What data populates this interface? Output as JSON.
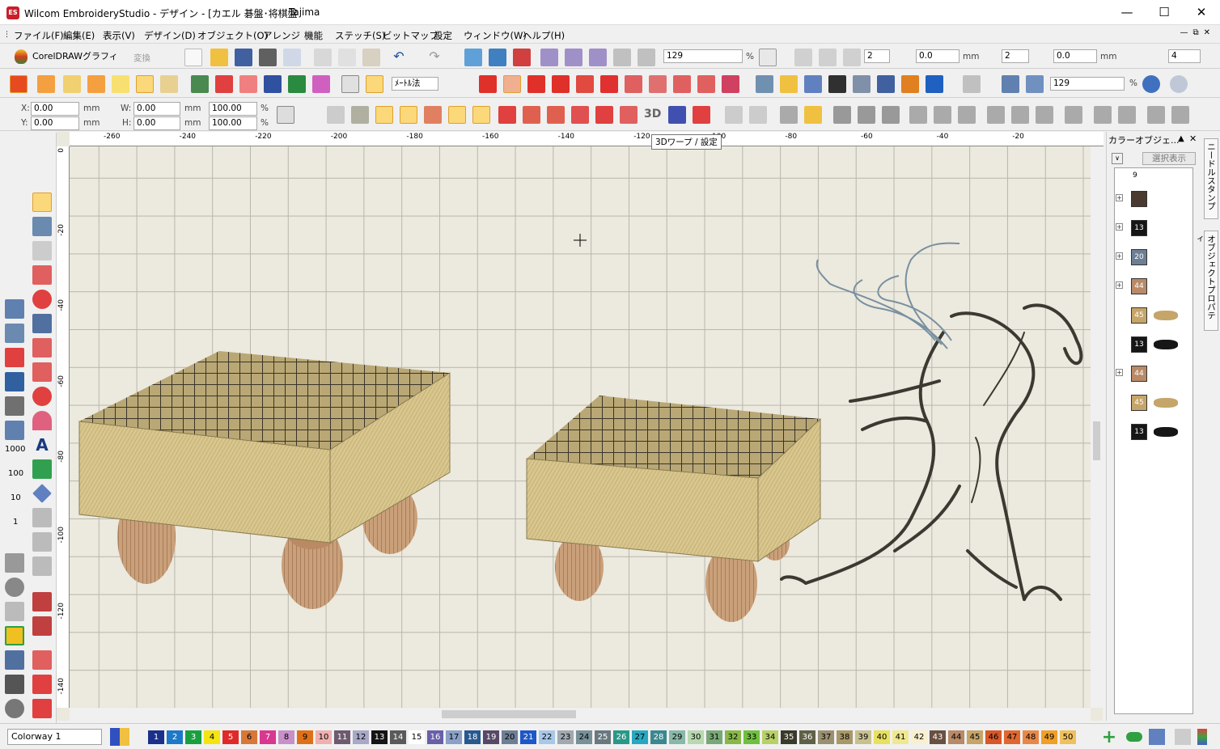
{
  "window": {
    "title": "Wilcom EmbroideryStudio - デザイン - [カエル 碁盤･将棋盤",
    "machine": "Tajima",
    "app_icon": "ES"
  },
  "menu": [
    "ファイル(F)",
    "編集(E)",
    "表示(V)",
    "デザイン(D)",
    "オブジェクト(O)",
    "アレンジ",
    "機能",
    "ステッチ(S)",
    "ビットマップ",
    "設定",
    "ウィンドウ(W)",
    "ヘルプ(H)"
  ],
  "toolbar": {
    "corel_label": "CorelDRAWグラフィック",
    "convert_label": "変換",
    "zoom1": "129",
    "zoom_unit": "%",
    "spin_a": "2",
    "spin_b": "0.0",
    "spin_c": "2",
    "spin_d": "0.0",
    "spin_e": "4",
    "unit_mm": "mm",
    "units_select": "ﾒｰﾄﾙ法",
    "zoom2": "129",
    "zoom2_unit": "%",
    "icon_3d": "3D"
  },
  "coords": {
    "x_label": "X:",
    "x": "0.00",
    "y_label": "Y:",
    "y": "0.00",
    "w_label": "W:",
    "w": "0.00",
    "h_label": "H:",
    "h": "0.00",
    "sx": "100.00",
    "sy": "100.00",
    "mm": "mm",
    "pct": "%"
  },
  "tooltip": "3Dワープ / 設定",
  "ruler": {
    "top": [
      "-260",
      "-240",
      "-220",
      "-200",
      "-180",
      "-160",
      "-140",
      "-120",
      "-100",
      "-80",
      "-60",
      "-40",
      "-20"
    ],
    "left": [
      "0",
      "-20",
      "-40",
      "-60",
      "-80",
      "-100",
      "-120",
      "-140"
    ],
    "vertical_tool_labels": [
      "1000",
      "100",
      "10",
      "1"
    ]
  },
  "color_object_panel": {
    "title": "カラーオブジェ...",
    "button": "選択表示",
    "count": "9",
    "rows": [
      {
        "code": "",
        "color": "#4a3a30",
        "expand": "+"
      },
      {
        "code": "13",
        "color": "#161616",
        "expand": "+"
      },
      {
        "code": "20",
        "color": "#6e7f95",
        "expand": "+"
      },
      {
        "code": "44",
        "color": "#b88a68",
        "expand": "+"
      },
      {
        "code": "45",
        "color": "#c6a56a",
        "expand": ""
      },
      {
        "code": "13",
        "color": "#161616",
        "expand": ""
      },
      {
        "code": "44",
        "color": "#b88a68",
        "expand": "+"
      },
      {
        "code": "45",
        "color": "#c6a56a",
        "expand": ""
      },
      {
        "code": "13",
        "color": "#161616",
        "expand": ""
      }
    ]
  },
  "side_tabs": [
    "ニードルスタンプ",
    "オブジェクトプロパティ"
  ],
  "status": {
    "colorway": "Colorway 1"
  },
  "palette": [
    {
      "n": "1",
      "c": "#1b2f8c"
    },
    {
      "n": "2",
      "c": "#1e78c8"
    },
    {
      "n": "3",
      "c": "#18a040"
    },
    {
      "n": "4",
      "c": "#f4e414"
    },
    {
      "n": "5",
      "c": "#e02a2a"
    },
    {
      "n": "6",
      "c": "#d87838"
    },
    {
      "n": "7",
      "c": "#d83890"
    },
    {
      "n": "8",
      "c": "#c890c8"
    },
    {
      "n": "9",
      "c": "#e07018"
    },
    {
      "n": "10",
      "c": "#f0b0b0"
    },
    {
      "n": "11",
      "c": "#6e5a6e"
    },
    {
      "n": "12",
      "c": "#a8a8c8"
    },
    {
      "n": "13",
      "c": "#141414"
    },
    {
      "n": "14",
      "c": "#5a5a5a"
    },
    {
      "n": "15",
      "c": "#ffffff"
    },
    {
      "n": "16",
      "c": "#6860a8"
    },
    {
      "n": "17",
      "c": "#8aa0c8"
    },
    {
      "n": "18",
      "c": "#285890"
    },
    {
      "n": "19",
      "c": "#584868"
    },
    {
      "n": "20",
      "c": "#6e7f95"
    },
    {
      "n": "21",
      "c": "#1c58c8"
    },
    {
      "n": "22",
      "c": "#a8c8e8"
    },
    {
      "n": "23",
      "c": "#a0a8b0"
    },
    {
      "n": "24",
      "c": "#789098"
    },
    {
      "n": "25",
      "c": "#6a7880"
    },
    {
      "n": "26",
      "c": "#2a9888"
    },
    {
      "n": "27",
      "c": "#28a8c0"
    },
    {
      "n": "28",
      "c": "#3a8890"
    },
    {
      "n": "29",
      "c": "#88b8a8"
    },
    {
      "n": "30",
      "c": "#b8d8b0"
    },
    {
      "n": "31",
      "c": "#78a878"
    },
    {
      "n": "32",
      "c": "#88b848"
    },
    {
      "n": "33",
      "c": "#70c040"
    },
    {
      "n": "34",
      "c": "#b8d068"
    },
    {
      "n": "35",
      "c": "#3a3a2a"
    },
    {
      "n": "36",
      "c": "#606048"
    },
    {
      "n": "37",
      "c": "#9a9070"
    },
    {
      "n": "38",
      "c": "#a89868"
    },
    {
      "n": "39",
      "c": "#c8c090"
    },
    {
      "n": "40",
      "c": "#e8e060"
    },
    {
      "n": "41",
      "c": "#f0e890"
    },
    {
      "n": "42",
      "c": "#f8f0d0"
    },
    {
      "n": "43",
      "c": "#6a5040"
    },
    {
      "n": "44",
      "c": "#b88a68"
    },
    {
      "n": "45",
      "c": "#c6a56a"
    },
    {
      "n": "46",
      "c": "#d8582a"
    },
    {
      "n": "47",
      "c": "#e06830"
    },
    {
      "n": "48",
      "c": "#e88848"
    },
    {
      "n": "49",
      "c": "#f0a028"
    },
    {
      "n": "50",
      "c": "#f0c060"
    }
  ]
}
